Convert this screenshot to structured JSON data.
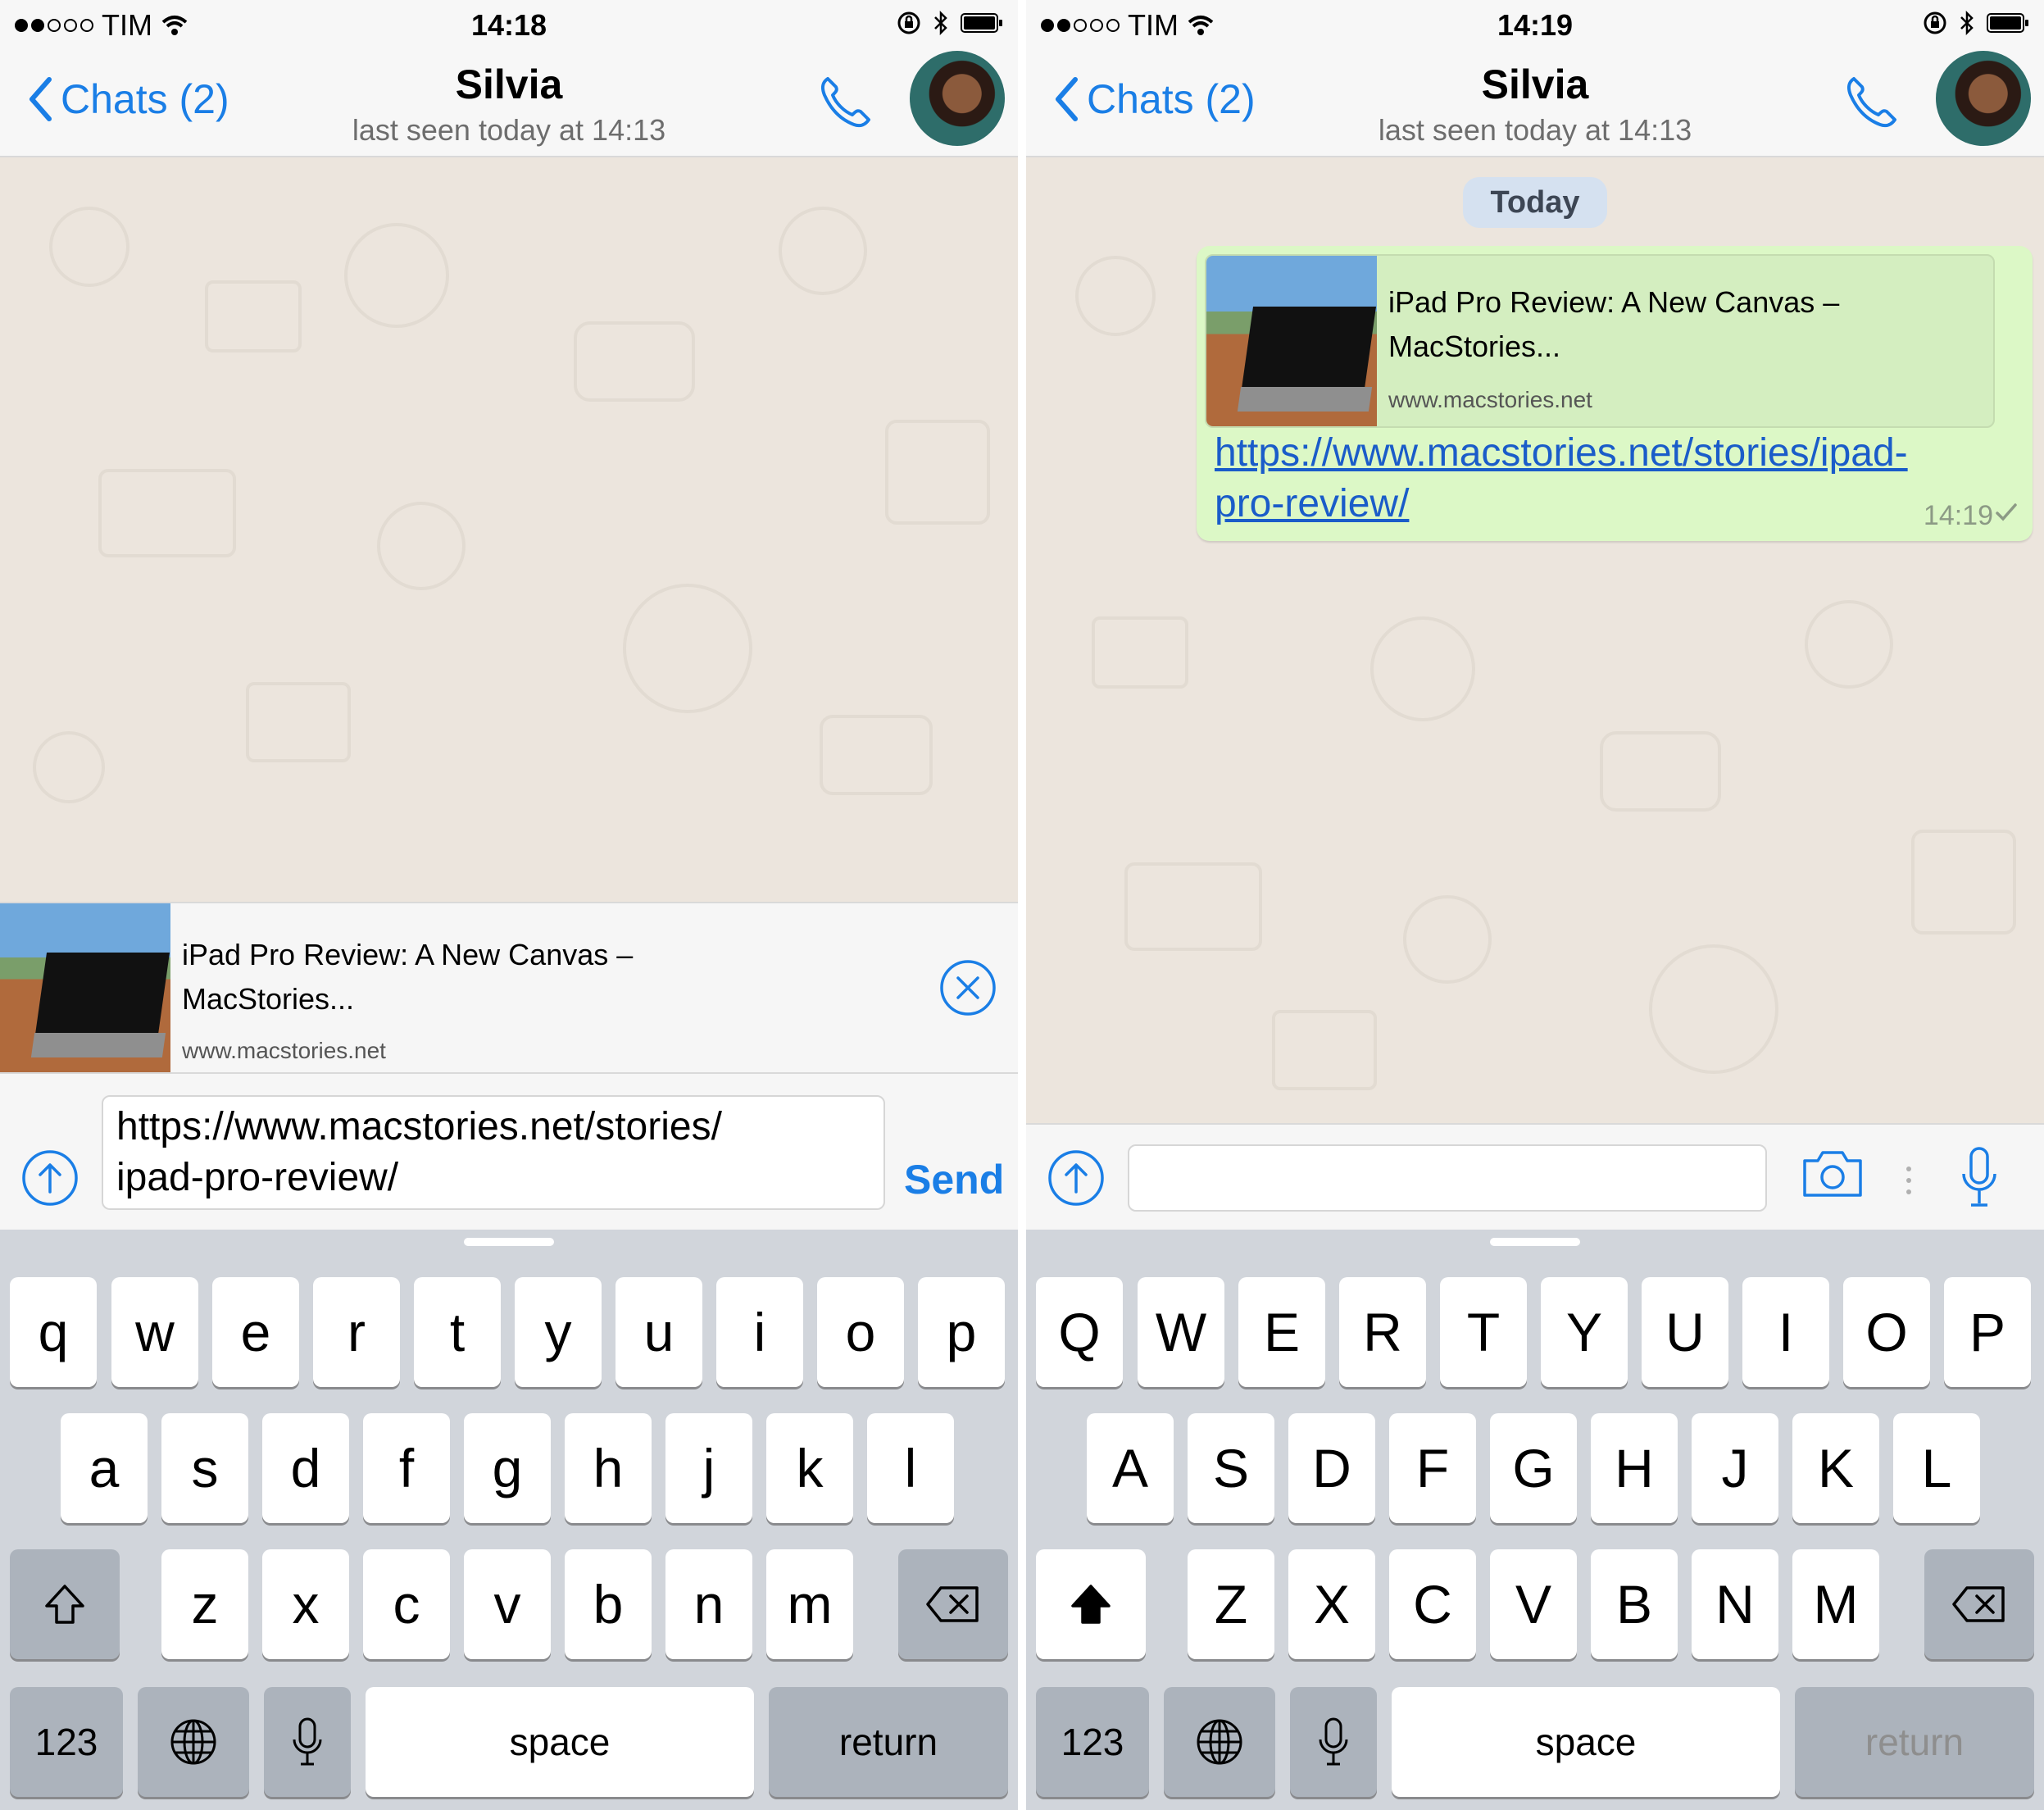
{
  "left": {
    "status": {
      "carrier": "TIM",
      "time": "14:18"
    },
    "nav": {
      "back_label": "Chats (2)",
      "title": "Silvia",
      "subtitle": "last seen today at 14:13"
    },
    "link_preview": {
      "title_line1": "iPad Pro Review: A New Canvas –",
      "title_line2": "MacStories...",
      "host": "www.macstories.net"
    },
    "composer": {
      "text_line1": "https://www.macstories.net/stories/",
      "text_line2": "ipad-pro-review/",
      "send_label": "Send"
    },
    "keyboard": {
      "row1": [
        "q",
        "w",
        "e",
        "r",
        "t",
        "y",
        "u",
        "i",
        "o",
        "p"
      ],
      "row2": [
        "a",
        "s",
        "d",
        "f",
        "g",
        "h",
        "j",
        "k",
        "l"
      ],
      "row3": [
        "z",
        "x",
        "c",
        "v",
        "b",
        "n",
        "m"
      ],
      "num_label": "123",
      "space_label": "space",
      "return_label": "return"
    }
  },
  "right": {
    "status": {
      "carrier": "TIM",
      "time": "14:19"
    },
    "nav": {
      "back_label": "Chats (2)",
      "title": "Silvia",
      "subtitle": "last seen today at 14:13"
    },
    "date_chip": "Today",
    "message": {
      "card_title_line1": "iPad Pro Review: A New Canvas –",
      "card_title_line2": "MacStories...",
      "card_host": "www.macstories.net",
      "link_line1": "https://www.macstories.net/stories/ipad-",
      "link_line2": "pro-review/",
      "time": "14:19"
    },
    "keyboard": {
      "row1": [
        "Q",
        "W",
        "E",
        "R",
        "T",
        "Y",
        "U",
        "I",
        "O",
        "P"
      ],
      "row2": [
        "A",
        "S",
        "D",
        "F",
        "G",
        "H",
        "J",
        "K",
        "L"
      ],
      "row3": [
        "Z",
        "X",
        "C",
        "V",
        "B",
        "N",
        "M"
      ],
      "num_label": "123",
      "space_label": "space",
      "return_label": "return"
    }
  },
  "colors": {
    "accent": "#1a7ee6",
    "bubble": "#dcf8c6",
    "chat_bg": "#ece5dd",
    "keyboard_bg": "#d1d5db"
  },
  "icons": [
    "back-chevron-icon",
    "phone-icon",
    "attach-icon",
    "close-icon",
    "camera-icon",
    "mic-icon",
    "shift-icon",
    "delete-icon",
    "globe-icon",
    "wifi-icon",
    "lock-rotation-icon",
    "bluetooth-icon",
    "battery-icon",
    "check-icon"
  ]
}
